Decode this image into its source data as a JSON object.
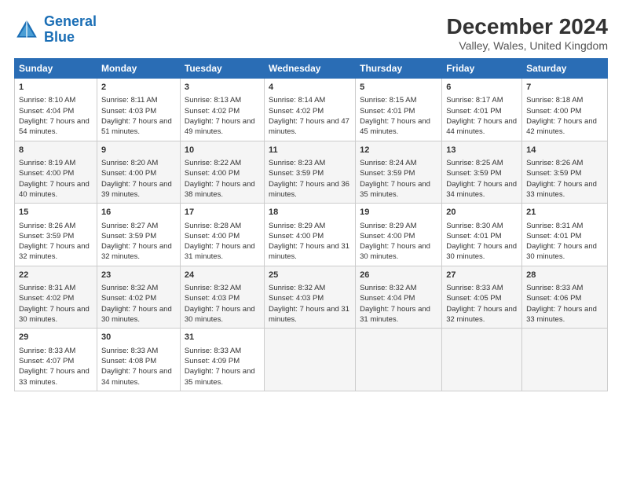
{
  "logo": {
    "line1": "General",
    "line2": "Blue"
  },
  "title": "December 2024",
  "subtitle": "Valley, Wales, United Kingdom",
  "headers": [
    "Sunday",
    "Monday",
    "Tuesday",
    "Wednesday",
    "Thursday",
    "Friday",
    "Saturday"
  ],
  "rows": [
    [
      {
        "day": "1",
        "sunrise": "Sunrise: 8:10 AM",
        "sunset": "Sunset: 4:04 PM",
        "daylight": "Daylight: 7 hours and 54 minutes."
      },
      {
        "day": "2",
        "sunrise": "Sunrise: 8:11 AM",
        "sunset": "Sunset: 4:03 PM",
        "daylight": "Daylight: 7 hours and 51 minutes."
      },
      {
        "day": "3",
        "sunrise": "Sunrise: 8:13 AM",
        "sunset": "Sunset: 4:02 PM",
        "daylight": "Daylight: 7 hours and 49 minutes."
      },
      {
        "day": "4",
        "sunrise": "Sunrise: 8:14 AM",
        "sunset": "Sunset: 4:02 PM",
        "daylight": "Daylight: 7 hours and 47 minutes."
      },
      {
        "day": "5",
        "sunrise": "Sunrise: 8:15 AM",
        "sunset": "Sunset: 4:01 PM",
        "daylight": "Daylight: 7 hours and 45 minutes."
      },
      {
        "day": "6",
        "sunrise": "Sunrise: 8:17 AM",
        "sunset": "Sunset: 4:01 PM",
        "daylight": "Daylight: 7 hours and 44 minutes."
      },
      {
        "day": "7",
        "sunrise": "Sunrise: 8:18 AM",
        "sunset": "Sunset: 4:00 PM",
        "daylight": "Daylight: 7 hours and 42 minutes."
      }
    ],
    [
      {
        "day": "8",
        "sunrise": "Sunrise: 8:19 AM",
        "sunset": "Sunset: 4:00 PM",
        "daylight": "Daylight: 7 hours and 40 minutes."
      },
      {
        "day": "9",
        "sunrise": "Sunrise: 8:20 AM",
        "sunset": "Sunset: 4:00 PM",
        "daylight": "Daylight: 7 hours and 39 minutes."
      },
      {
        "day": "10",
        "sunrise": "Sunrise: 8:22 AM",
        "sunset": "Sunset: 4:00 PM",
        "daylight": "Daylight: 7 hours and 38 minutes."
      },
      {
        "day": "11",
        "sunrise": "Sunrise: 8:23 AM",
        "sunset": "Sunset: 3:59 PM",
        "daylight": "Daylight: 7 hours and 36 minutes."
      },
      {
        "day": "12",
        "sunrise": "Sunrise: 8:24 AM",
        "sunset": "Sunset: 3:59 PM",
        "daylight": "Daylight: 7 hours and 35 minutes."
      },
      {
        "day": "13",
        "sunrise": "Sunrise: 8:25 AM",
        "sunset": "Sunset: 3:59 PM",
        "daylight": "Daylight: 7 hours and 34 minutes."
      },
      {
        "day": "14",
        "sunrise": "Sunrise: 8:26 AM",
        "sunset": "Sunset: 3:59 PM",
        "daylight": "Daylight: 7 hours and 33 minutes."
      }
    ],
    [
      {
        "day": "15",
        "sunrise": "Sunrise: 8:26 AM",
        "sunset": "Sunset: 3:59 PM",
        "daylight": "Daylight: 7 hours and 32 minutes."
      },
      {
        "day": "16",
        "sunrise": "Sunrise: 8:27 AM",
        "sunset": "Sunset: 3:59 PM",
        "daylight": "Daylight: 7 hours and 32 minutes."
      },
      {
        "day": "17",
        "sunrise": "Sunrise: 8:28 AM",
        "sunset": "Sunset: 4:00 PM",
        "daylight": "Daylight: 7 hours and 31 minutes."
      },
      {
        "day": "18",
        "sunrise": "Sunrise: 8:29 AM",
        "sunset": "Sunset: 4:00 PM",
        "daylight": "Daylight: 7 hours and 31 minutes."
      },
      {
        "day": "19",
        "sunrise": "Sunrise: 8:29 AM",
        "sunset": "Sunset: 4:00 PM",
        "daylight": "Daylight: 7 hours and 30 minutes."
      },
      {
        "day": "20",
        "sunrise": "Sunrise: 8:30 AM",
        "sunset": "Sunset: 4:01 PM",
        "daylight": "Daylight: 7 hours and 30 minutes."
      },
      {
        "day": "21",
        "sunrise": "Sunrise: 8:31 AM",
        "sunset": "Sunset: 4:01 PM",
        "daylight": "Daylight: 7 hours and 30 minutes."
      }
    ],
    [
      {
        "day": "22",
        "sunrise": "Sunrise: 8:31 AM",
        "sunset": "Sunset: 4:02 PM",
        "daylight": "Daylight: 7 hours and 30 minutes."
      },
      {
        "day": "23",
        "sunrise": "Sunrise: 8:32 AM",
        "sunset": "Sunset: 4:02 PM",
        "daylight": "Daylight: 7 hours and 30 minutes."
      },
      {
        "day": "24",
        "sunrise": "Sunrise: 8:32 AM",
        "sunset": "Sunset: 4:03 PM",
        "daylight": "Daylight: 7 hours and 30 minutes."
      },
      {
        "day": "25",
        "sunrise": "Sunrise: 8:32 AM",
        "sunset": "Sunset: 4:03 PM",
        "daylight": "Daylight: 7 hours and 31 minutes."
      },
      {
        "day": "26",
        "sunrise": "Sunrise: 8:32 AM",
        "sunset": "Sunset: 4:04 PM",
        "daylight": "Daylight: 7 hours and 31 minutes."
      },
      {
        "day": "27",
        "sunrise": "Sunrise: 8:33 AM",
        "sunset": "Sunset: 4:05 PM",
        "daylight": "Daylight: 7 hours and 32 minutes."
      },
      {
        "day": "28",
        "sunrise": "Sunrise: 8:33 AM",
        "sunset": "Sunset: 4:06 PM",
        "daylight": "Daylight: 7 hours and 33 minutes."
      }
    ],
    [
      {
        "day": "29",
        "sunrise": "Sunrise: 8:33 AM",
        "sunset": "Sunset: 4:07 PM",
        "daylight": "Daylight: 7 hours and 33 minutes."
      },
      {
        "day": "30",
        "sunrise": "Sunrise: 8:33 AM",
        "sunset": "Sunset: 4:08 PM",
        "daylight": "Daylight: 7 hours and 34 minutes."
      },
      {
        "day": "31",
        "sunrise": "Sunrise: 8:33 AM",
        "sunset": "Sunset: 4:09 PM",
        "daylight": "Daylight: 7 hours and 35 minutes."
      },
      null,
      null,
      null,
      null
    ]
  ]
}
